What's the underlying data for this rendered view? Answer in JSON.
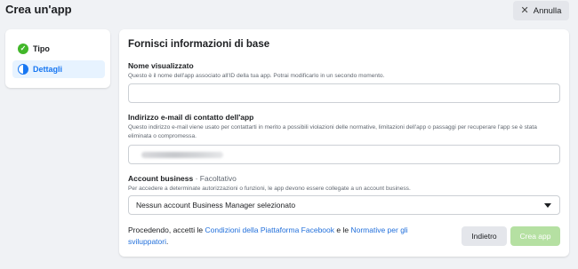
{
  "header": {
    "title": "Crea un'app",
    "cancel_label": "Annulla"
  },
  "steps": [
    {
      "label": "Tipo",
      "status": "complete"
    },
    {
      "label": "Dettagli",
      "status": "current"
    }
  ],
  "form": {
    "title": "Fornisci informazioni di base",
    "display_name": {
      "label": "Nome visualizzato",
      "help": "Questo è il nome dell'app associato all'ID della tua app. Potrai modificarlo in un secondo momento.",
      "value": ""
    },
    "contact_email": {
      "label": "Indirizzo e-mail di contatto dell'app",
      "help": "Questo indirizzo e-mail viene usato per contattarti in merito a possibili violazioni delle normative, limitazioni dell'app o passaggi per recuperare l'app se è stata eliminata o compromessa."
    },
    "business_account": {
      "label": "Account business",
      "optional": "· Facoltativo",
      "help": "Per accedere a determinate autorizzazioni o funzioni, le app devono essere collegate a un account business.",
      "selected": "Nessun account Business Manager selezionato"
    },
    "terms": {
      "prefix": "Procedendo, accetti le ",
      "link1": "Condizioni della Piattaforma Facebook",
      "middle": " e le ",
      "link2": "Normative per gli sviluppatori",
      "suffix": "."
    },
    "back_label": "Indietro",
    "create_label": "Crea app"
  },
  "colors": {
    "background": "#f0f2f5",
    "accent": "#1877f2",
    "link": "#216fdb",
    "success": "#42b72a",
    "create_disabled": "#b5e0a2"
  },
  "icons": [
    "close-icon",
    "check-circle-icon",
    "half-circle-icon",
    "chevron-down-icon"
  ]
}
